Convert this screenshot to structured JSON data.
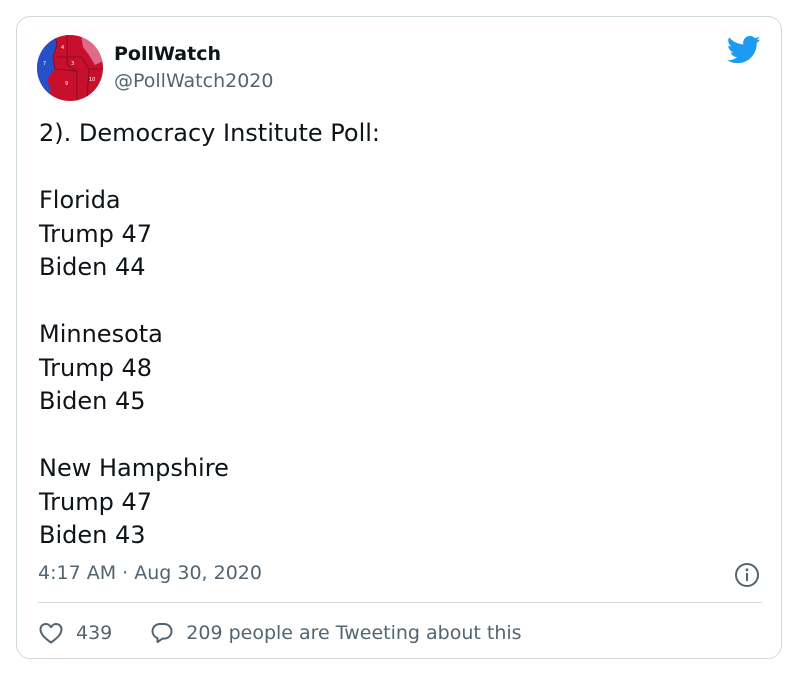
{
  "author": {
    "name": "PollWatch",
    "handle": "@PollWatch2020"
  },
  "tweet": {
    "lines": [
      "2). Democracy Institute Poll:",
      "",
      "Florida",
      "Trump 47",
      "Biden 44",
      "",
      "Minnesota",
      "Trump 48",
      "Biden 45",
      "",
      "New Hampshire",
      "Trump 47",
      "Biden 43"
    ],
    "timestamp": "4:17 AM · Aug 30, 2020"
  },
  "actions": {
    "like_count": "439",
    "reply_label": "209 people are Tweeting about this"
  },
  "icons": {
    "brand": "twitter-bird-icon",
    "info": "info-icon",
    "like": "heart-icon",
    "reply": "speech-bubble-icon"
  },
  "colors": {
    "text": "#0f1419",
    "secondary": "#536471",
    "twitter_blue": "#1d9bf0",
    "border": "#cfd9de"
  }
}
